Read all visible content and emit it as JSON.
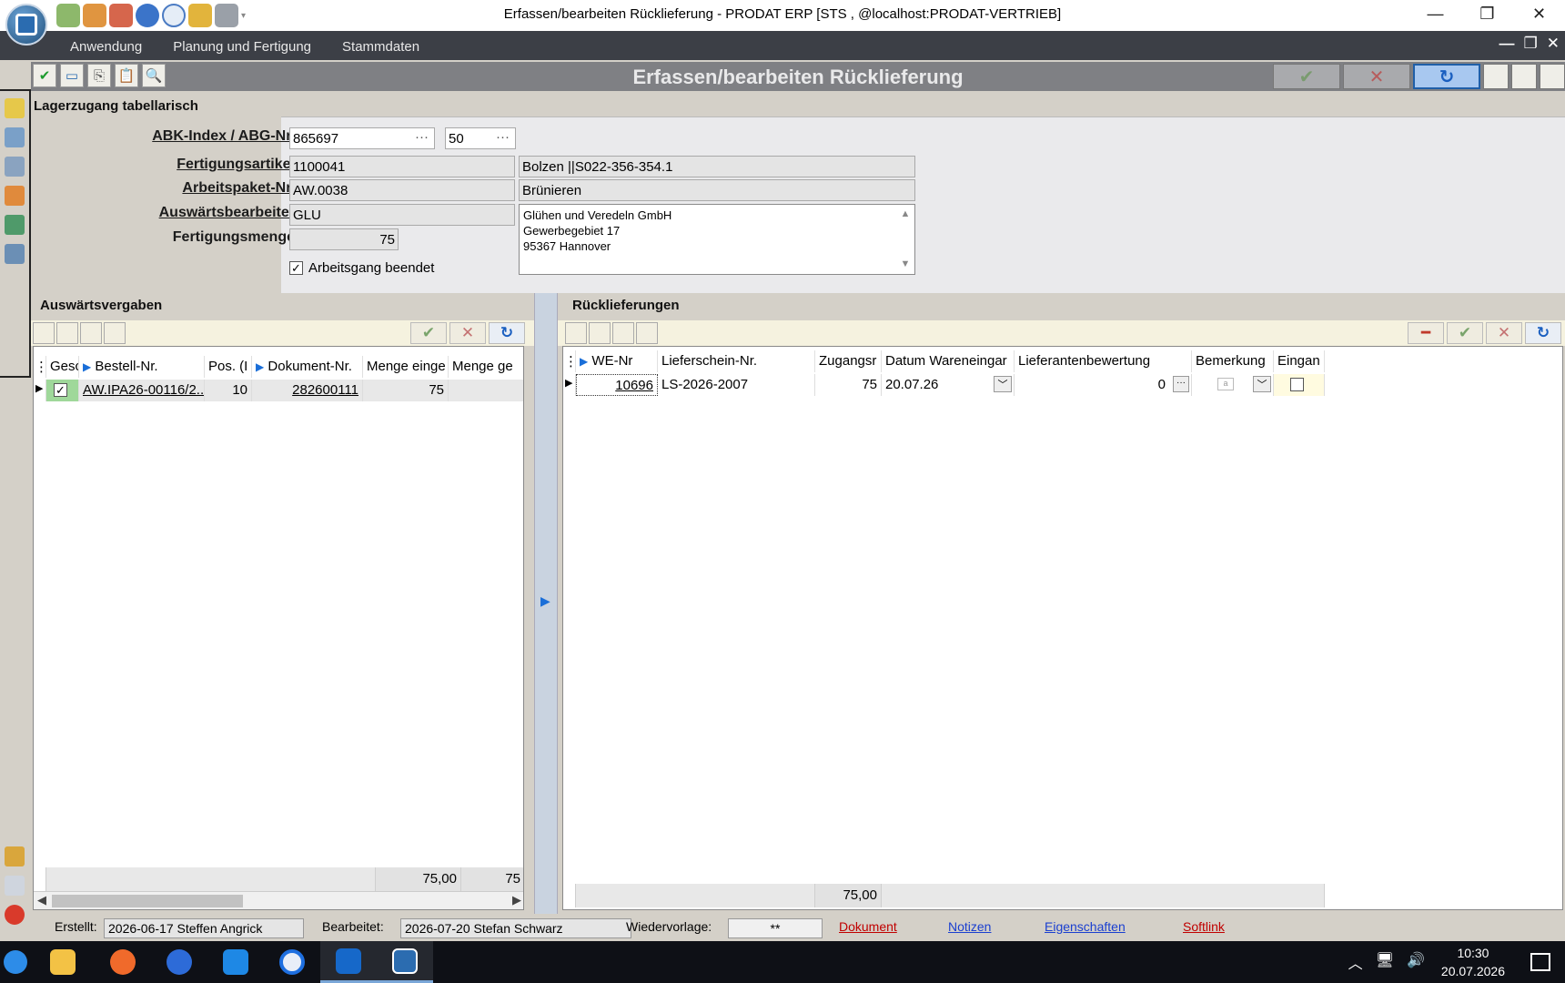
{
  "window": {
    "title": "Erfassen/bearbeiten Rücklieferung - PRODAT ERP   [STS , @localhost:PRODAT-VERTRIEB]",
    "minimize": "—",
    "restore": "❐",
    "close": "✕"
  },
  "menu": [
    "Anwendung",
    "Planung und Fertigung",
    "Stammdaten"
  ],
  "mdi": {
    "min": "—",
    "restore": "❐",
    "close": "✕"
  },
  "form": {
    "title": "Erfassen/bearbeiten Rücklieferung"
  },
  "header": {
    "section": "Lagerzugang tabellarisch",
    "labels": {
      "abk": "ABK-Index / ABG-Nr.",
      "artikel": "Fertigungsartikel",
      "paket": "Arbeitspaket-Nr.",
      "bearbeiter": "Auswärtsbearbeiter",
      "menge": "Fertigungsmenge"
    },
    "abk_index": "865697",
    "abg_nr": "50",
    "artikel_nr": "1100041",
    "artikel_bez": "Bolzen    ||S022-356-354.1",
    "paket_nr": "AW.0038",
    "paket_bez": "Brünieren",
    "bearbeiter": "GLU",
    "address": [
      "Glühen und Veredeln GmbH",
      "Gewerbegebiet 17",
      "95367 Hannover"
    ],
    "menge": "75",
    "arbeitsgang_beendet": "Arbeitsgang beendet",
    "arbeitsgang_checked": true
  },
  "left_panel": {
    "title": "Auswärtsvergaben",
    "columns": [
      "Gesc",
      "Bestell-Nr.",
      "Pos. (I",
      "Dokument-Nr.",
      "Menge einge",
      "Menge ge"
    ],
    "rows": [
      {
        "checked": true,
        "bestell": "AW.IPA26-00116/2...",
        "pos": "10",
        "dokument": "282600111",
        "menge_ein": "75",
        "menge_ge": ""
      }
    ],
    "footer": [
      "75,00",
      "75"
    ]
  },
  "right_panel": {
    "title": "Rücklieferungen",
    "columns": [
      "WE-Nr",
      "Lieferschein-Nr.",
      "Zugangsr",
      "Datum Wareneingar",
      "Lieferantenbewertung",
      "Bemerkung",
      "Eingan"
    ],
    "rows": [
      {
        "we_nr": "10696",
        "lieferschein": "LS-2026-2007",
        "zugang": "75",
        "datum": "20.07.26",
        "bewertung": "0",
        "bemerkung": "",
        "eingang": false
      }
    ],
    "footer": "75,00"
  },
  "status": {
    "erstellt_label": "Erstellt:",
    "erstellt": "2026-06-17  Steffen Angrick",
    "bearbeitet_label": "Bearbeitet:",
    "bearbeitet": "2026-07-20  Stefan Schwarz",
    "wiedervorlage_label": "Wiedervorlage:",
    "wiedervorlage": "**",
    "links": [
      "Dokument",
      "Notizen",
      "Eigenschaften",
      "Softlink"
    ]
  },
  "taskbar": {
    "time": "10:30",
    "date": "20.07.2026"
  },
  "colors": {
    "menubar": "#3c3f46",
    "formbar": "#7f8084",
    "taskbar": "#0e1016",
    "link_red": "#c00000",
    "link_blue": "#1a3fd0"
  }
}
